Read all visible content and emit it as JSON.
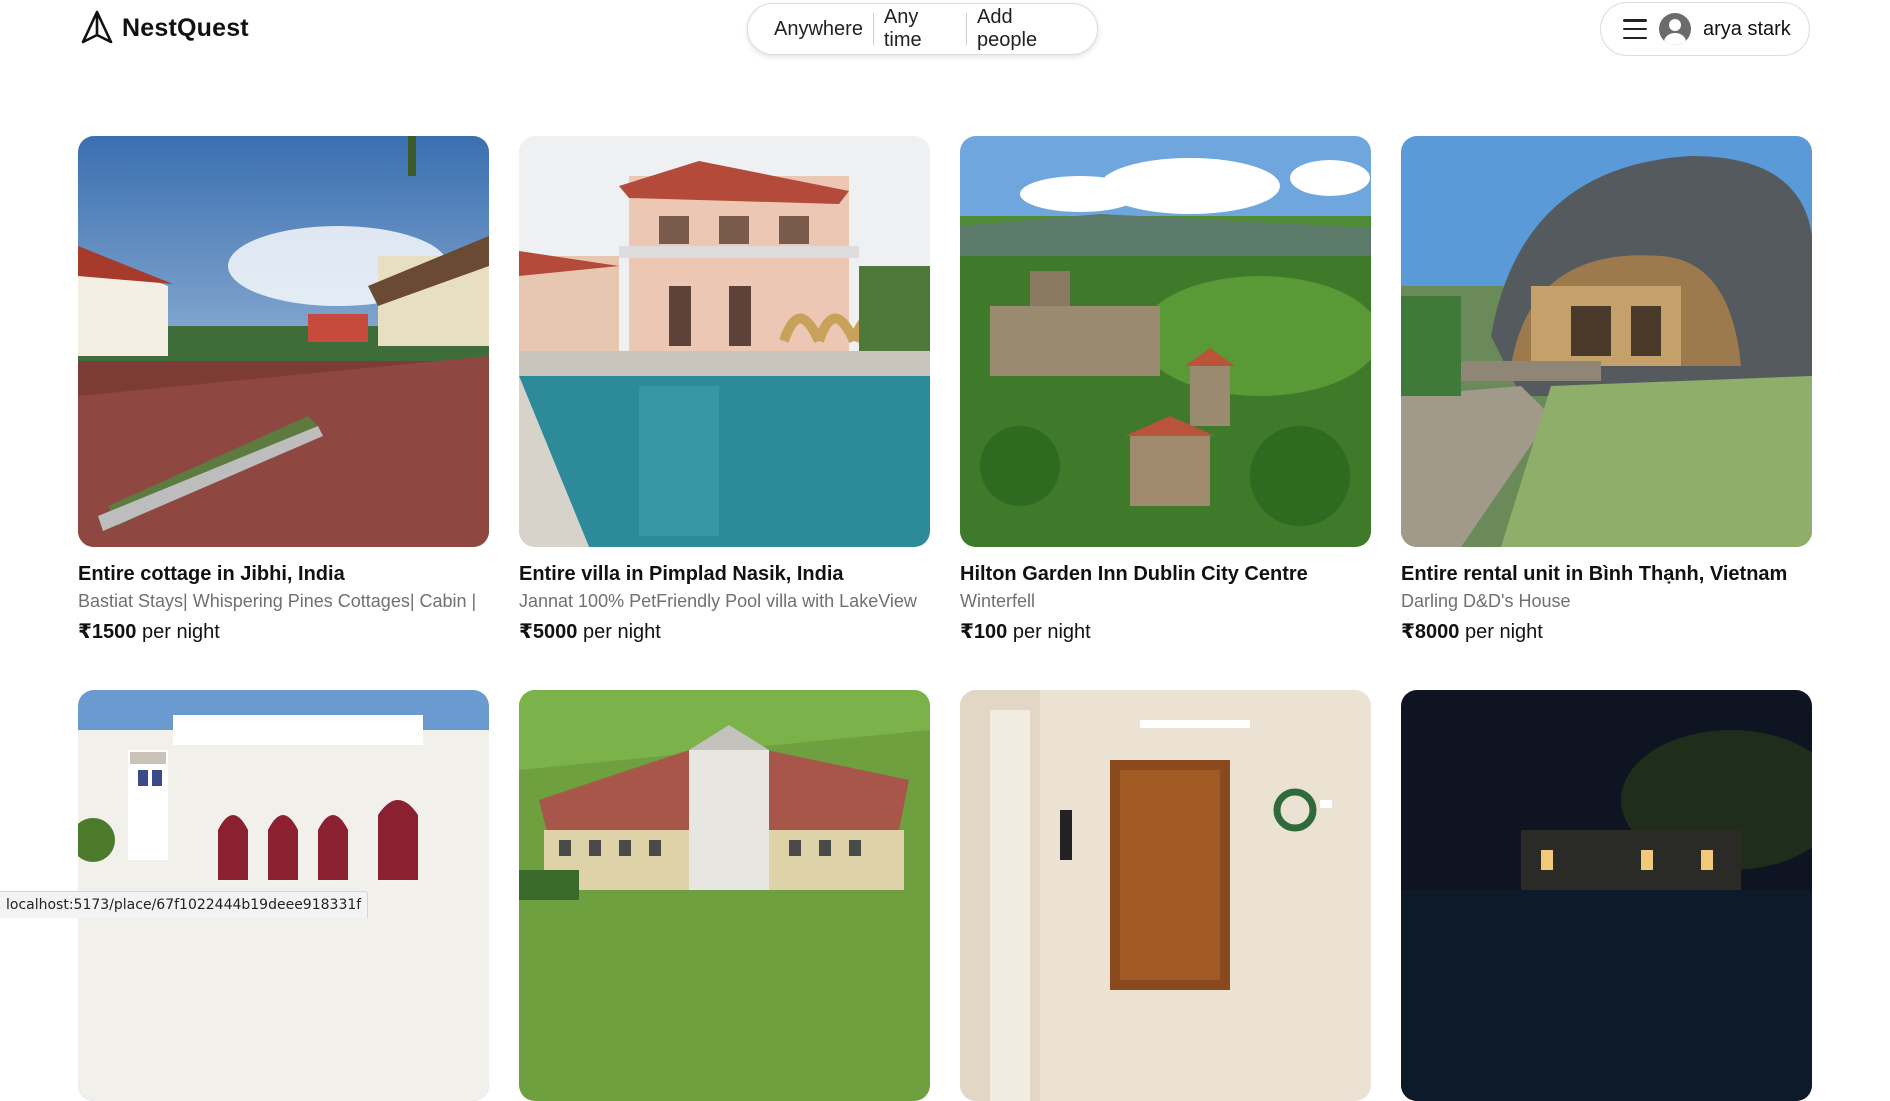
{
  "header": {
    "logo_text": "NestQuest",
    "search": {
      "where": "Anywhere",
      "when": "Any time",
      "who": "Add people"
    },
    "user": {
      "name": "arya stark"
    }
  },
  "listings": [
    {
      "title": "Entire cottage in Jibhi, India",
      "subtitle": "Bastiat Stays| Whispering Pines Cottages| Cabin |",
      "price": "₹1500",
      "per": " per night"
    },
    {
      "title": "Entire villa in Pimplad Nasik, India",
      "subtitle": "Jannat 100% PetFriendly Pool villa with LakeView",
      "price": "₹5000",
      "per": " per night"
    },
    {
      "title": "Hilton Garden Inn Dublin City Centre",
      "subtitle": "Winterfell",
      "price": "₹100",
      "per": " per night"
    },
    {
      "title": "Entire rental unit in Bình Thạnh, Vietnam",
      "subtitle": "Darling D&D's House",
      "price": "₹8000",
      "per": " per night"
    }
  ],
  "statusbar": {
    "url": "localhost:5173/place/67f1022444b19deee918331f"
  }
}
